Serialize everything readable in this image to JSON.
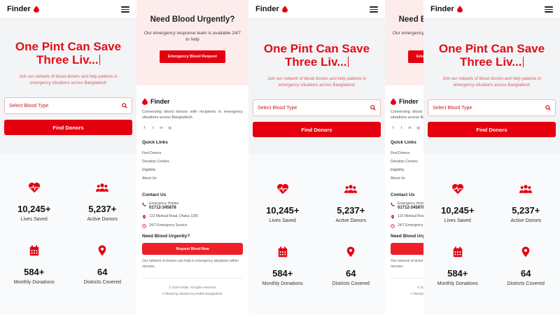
{
  "app": {
    "name": "Finder"
  },
  "hero": {
    "title_line1": "One Pint Can Save",
    "title_line2": "Three Liv...",
    "subtitle": "Join our network of blood donors and help patients in emergency situations across Bangladesh",
    "search_placeholder": "Select Blood Type",
    "find_button": "Find Donors"
  },
  "stats": [
    {
      "icon": "heartbeat-icon",
      "number": "10,245+",
      "label": "Lives Saved"
    },
    {
      "icon": "users-icon",
      "number": "5,237+",
      "label": "Active Donors"
    },
    {
      "icon": "calendar-icon",
      "number": "584+",
      "label": "Monthly Donations"
    },
    {
      "icon": "map-pin-icon",
      "number": "64",
      "label": "Districts Covered"
    }
  ],
  "urgent": {
    "heading": "Need Blood Urgently?",
    "text": "Our emergency response team is available 24/7 to help",
    "button": "Emergency Blood Request"
  },
  "footer": {
    "brand": "Finder",
    "description": "Connecting blood donors with recipients in emergency situations across Bangladesh.",
    "social": [
      "f",
      "t",
      "in",
      "ig"
    ],
    "quick_links_title": "Quick Links",
    "quick_links": [
      "Find Donors",
      "Donation Centers",
      "Eligibility",
      "About Us"
    ],
    "contact_title": "Contact Us",
    "hotline_label": "Emergency Hotline",
    "hotline_number": "01712-345678",
    "address": "123 Medical Road, Dhaka 1205",
    "service": "24/7 Emergency Service",
    "need_title": "Need Blood Urgently?",
    "request_button": "Request Blood Now",
    "need_text": "Our network of donors can help in emergency situations within minutes.",
    "copyright": "© 2025 Finder. All rights reserved.",
    "initiative": "A lifesaving initiative by Health Bangladesh."
  },
  "colors": {
    "primary": "#e4000f",
    "accent_text": "#e20e17",
    "hero_bg": "#f3f4f6",
    "urgent_bg": "#fdecec"
  }
}
